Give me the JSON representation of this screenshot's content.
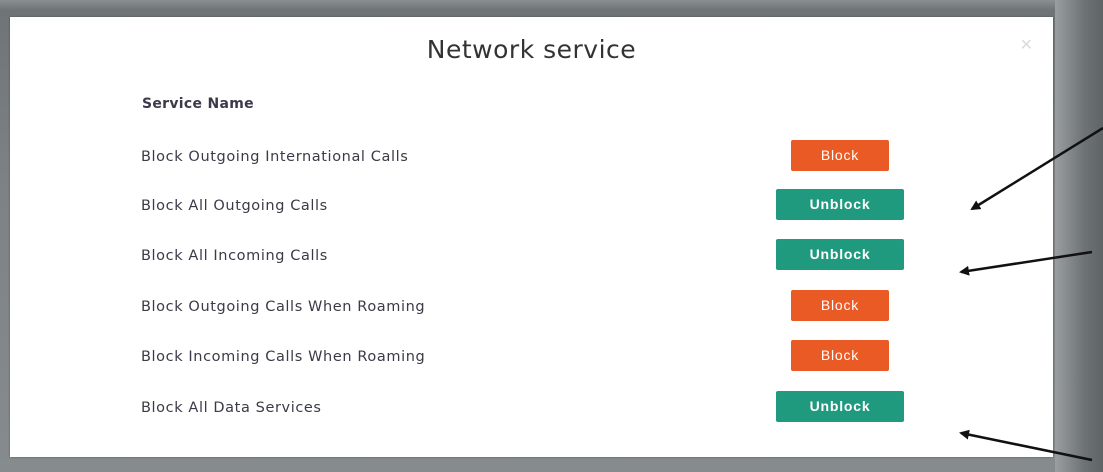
{
  "dialog": {
    "title": "Network service",
    "close_icon": "close-icon",
    "column_header": "Service Name"
  },
  "services": [
    {
      "label": "Block Outgoing International Calls",
      "action": "Block"
    },
    {
      "label": "Block All Outgoing Calls",
      "action": "Unblock"
    },
    {
      "label": "Block All Incoming Calls",
      "action": "Unblock"
    },
    {
      "label": "Block Outgoing Calls When Roaming",
      "action": "Block"
    },
    {
      "label": "Block Incoming Calls When Roaming",
      "action": "Block"
    },
    {
      "label": "Block All Data Services",
      "action": "Unblock"
    }
  ],
  "colors": {
    "block": "#ea5a24",
    "unblock": "#1f9a7f"
  }
}
